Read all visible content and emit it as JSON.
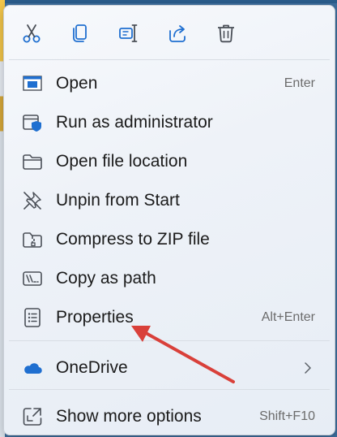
{
  "toolbar": {
    "icons": [
      "cut-icon",
      "copy-icon",
      "rename-icon",
      "share-icon",
      "delete-icon"
    ]
  },
  "menu": {
    "items": [
      {
        "label": "Open",
        "shortcut": "Enter",
        "icon": "open-app-icon"
      },
      {
        "label": "Run as administrator",
        "shortcut": "",
        "icon": "shield-admin-icon"
      },
      {
        "label": "Open file location",
        "shortcut": "",
        "icon": "folder-icon"
      },
      {
        "label": "Unpin from Start",
        "shortcut": "",
        "icon": "unpin-icon"
      },
      {
        "label": "Compress to ZIP file",
        "shortcut": "",
        "icon": "zip-folder-icon"
      },
      {
        "label": "Copy as path",
        "shortcut": "",
        "icon": "copy-path-icon"
      },
      {
        "label": "Properties",
        "shortcut": "Alt+Enter",
        "icon": "properties-icon"
      }
    ],
    "onedrive": {
      "label": "OneDrive",
      "icon": "cloud-icon",
      "has_submenu": true
    },
    "more": {
      "label": "Show more options",
      "shortcut": "Shift+F10",
      "icon": "show-more-icon"
    }
  },
  "colors": {
    "accent_blue": "#1f6fd0",
    "icon_stroke": "#4a4f57",
    "annotation_arrow": "#d9403a"
  }
}
